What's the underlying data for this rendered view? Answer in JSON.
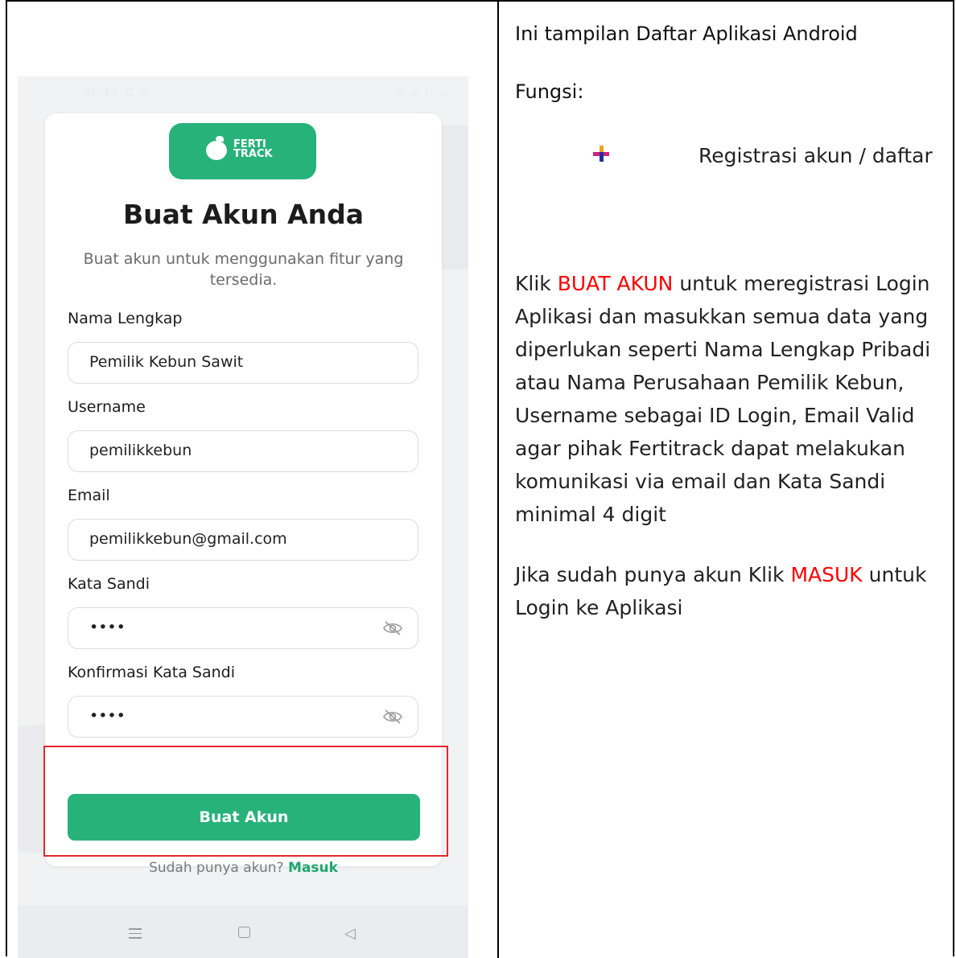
{
  "phone": {
    "status": {
      "time": "06:43",
      "left_icons": "G ⚲",
      "right_icons": "⊙ ≋ ıl ▭"
    },
    "logo": {
      "line1": "FERTI",
      "line2": "TRACK"
    },
    "title": "Buat Akun Anda",
    "subtitle": "Buat akun untuk menggunakan fitur yang tersedia.",
    "fields": [
      {
        "label": "Nama Lengkap",
        "value": "Pemilik Kebun Sawit"
      },
      {
        "label": "Username",
        "value": "pemilikkebun"
      },
      {
        "label": "Email",
        "value": "pemilikkebun@gmail.com"
      },
      {
        "label": "Kata Sandi",
        "value": "••••"
      },
      {
        "label": "Konfirmasi Kata Sandi",
        "value": "••••"
      }
    ],
    "primary_button": "Buat Akun",
    "signin_prompt": "Sudah punya akun?",
    "signin_link": "Masuk"
  },
  "doc": {
    "heading": "Ini tampilan Daftar Aplikasi Android",
    "fungsi_label": "Fungsi:",
    "bullet": "Registrasi akun / daftar",
    "para1_prefix": "Klik ",
    "para1_highlight": "BUAT AKUN",
    "para1_suffix": " untuk meregistrasi Login Aplikasi dan masukkan semua data yang diperlukan seperti Nama Lengkap Pribadi atau Nama Perusahaan Pemilik Kebun, Username sebagai ID Login, Email Valid agar pihak Fertitrack dapat melakukan komunikasi via email dan Kata Sandi minimal 4 digit",
    "para2_prefix": "Jika sudah punya akun Klik ",
    "para2_highlight": "MASUK",
    "para2_suffix": " untuk Login ke Aplikasi"
  },
  "colors": {
    "brand": "#27b27a",
    "highlight_border": "#e0282e",
    "emphasis_text": "#ff0000"
  }
}
